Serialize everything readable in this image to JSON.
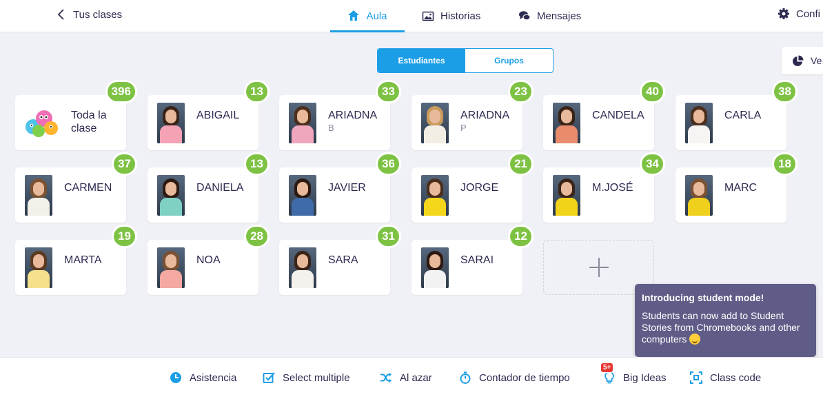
{
  "topbar": {
    "back_label": "Tus clases",
    "tabs": [
      {
        "label": "Aula",
        "icon": "home-icon",
        "active": true
      },
      {
        "label": "Historias",
        "icon": "image-icon",
        "active": false
      },
      {
        "label": "Mensajes",
        "icon": "chat-icon",
        "active": false
      }
    ],
    "settings_label": "Confi"
  },
  "segment": {
    "students": "Estudiantes",
    "groups": "Grupos",
    "selected": "Estudiantes"
  },
  "view_button": {
    "label": "Ve"
  },
  "whole_class": {
    "label": "Toda la clase",
    "points": "396"
  },
  "students": [
    {
      "name": "ABIGAIL",
      "sub": "",
      "points": "13",
      "shirt": "#f5a3b4",
      "hair": "#3a2418"
    },
    {
      "name": "ARIADNA",
      "sub": "B",
      "points": "33",
      "shirt": "#f0a6bd",
      "hair": "#4b2e1c"
    },
    {
      "name": "ARIADNA",
      "sub": "P",
      "points": "23",
      "shirt": "#f3eee4",
      "hair": "#c89b5d"
    },
    {
      "name": "CANDELA",
      "sub": "",
      "points": "40",
      "shirt": "#e98b6d",
      "hair": "#3a2418"
    },
    {
      "name": "CARLA",
      "sub": "",
      "points": "38",
      "shirt": "#f7f4f4",
      "hair": "#4b2e1c"
    },
    {
      "name": "CARMEN",
      "sub": "",
      "points": "37",
      "shirt": "#f3f0e9",
      "hair": "#7a5233"
    },
    {
      "name": "DANIELA",
      "sub": "",
      "points": "13",
      "shirt": "#7fd1c4",
      "hair": "#2c1a12"
    },
    {
      "name": "JAVIER",
      "sub": "",
      "points": "36",
      "shirt": "#3f6ca8",
      "hair": "#2c1a12"
    },
    {
      "name": "JORGE",
      "sub": "",
      "points": "21",
      "shirt": "#f4d61b",
      "hair": "#4b2e1c"
    },
    {
      "name": "M.JOSÉ",
      "sub": "",
      "points": "34",
      "shirt": "#f1d41a",
      "hair": "#3a2418"
    },
    {
      "name": "MARC",
      "sub": "",
      "points": "18",
      "shirt": "#efd01c",
      "hair": "#7a5233"
    },
    {
      "name": "MARTA",
      "sub": "",
      "points": "19",
      "shirt": "#f6e08c",
      "hair": "#5b3a22"
    },
    {
      "name": "NOA",
      "sub": "",
      "points": "28",
      "shirt": "#f3a8a1",
      "hair": "#7a5233"
    },
    {
      "name": "SARA",
      "sub": "",
      "points": "31",
      "shirt": "#f5f2ee",
      "hair": "#3a2418"
    },
    {
      "name": "SARAI",
      "sub": "",
      "points": "12",
      "shirt": "#f2f2f2",
      "hair": "#2c1a12"
    }
  ],
  "tooltip": {
    "title": "Introducing student mode!",
    "body": "Students can now add to Student Stories from Chromebooks and other computers"
  },
  "toolbar": [
    {
      "label": "Asistencia",
      "icon": "clock-icon"
    },
    {
      "label": "Select multiple",
      "icon": "checkbox-icon"
    },
    {
      "label": "Al azar",
      "icon": "shuffle-icon"
    },
    {
      "label": "Contador de tiempo",
      "icon": "stopwatch-icon"
    },
    {
      "label": "Big Ideas",
      "icon": "lightbulb-icon",
      "badge": "5+"
    },
    {
      "label": "Class code",
      "icon": "qr-code-icon"
    }
  ],
  "colors": {
    "accent": "#1c9ee6",
    "points_badge": "#7ec244",
    "tooltip": "#5f5d87"
  }
}
